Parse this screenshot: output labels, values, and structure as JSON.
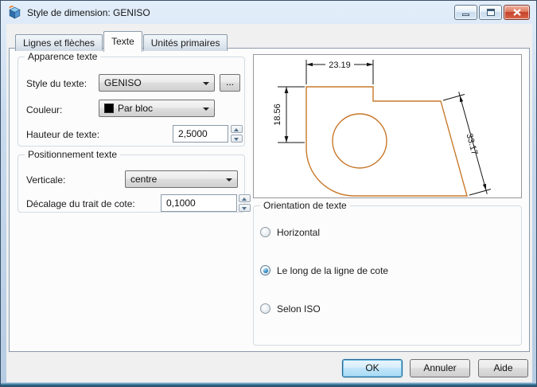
{
  "window": {
    "title": "Style de dimension: GENISO"
  },
  "tabs": [
    {
      "label": "Lignes et flèches",
      "active": false
    },
    {
      "label": "Texte",
      "active": true
    },
    {
      "label": "Unités primaires",
      "active": false
    }
  ],
  "apparence": {
    "title": "Apparence texte",
    "style_label": "Style du texte:",
    "style_value": "GENISO",
    "browse_label": "...",
    "couleur_label": "Couleur:",
    "couleur_value": "Par bloc",
    "couleur_swatch": "#000000",
    "hauteur_label": "Hauteur de texte:",
    "hauteur_value": "2,5000"
  },
  "positionnement": {
    "title": "Positionnement texte",
    "verticale_label": "Verticale:",
    "verticale_value": "centre",
    "decalage_label": "Décalage du trait de cote:",
    "decalage_value": "0,1000"
  },
  "orientation": {
    "title": "Orientation de texte",
    "options": [
      {
        "label": "Horizontal",
        "selected": false
      },
      {
        "label": "Le long de la ligne de cote",
        "selected": true
      },
      {
        "label": "Selon ISO",
        "selected": false
      }
    ]
  },
  "preview": {
    "dim_horizontal": "23.19",
    "dim_vertical": "18.56",
    "dim_aligned": "33.17",
    "shape_color": "#c8782a",
    "dimension_color": "#141414"
  },
  "buttons": {
    "ok": "OK",
    "cancel": "Annuler",
    "help": "Aide"
  }
}
